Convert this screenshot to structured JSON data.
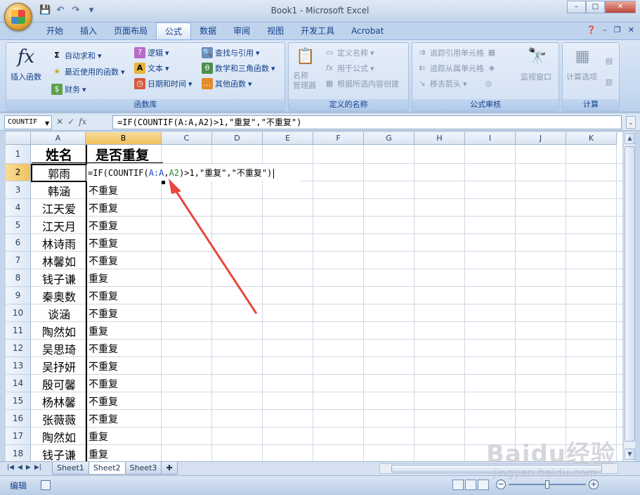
{
  "window": {
    "title": "Book1 - Microsoft Excel",
    "controls": [
      "–",
      "□",
      "✕"
    ]
  },
  "qat": [
    "save-icon",
    "undo-icon",
    "redo-icon",
    "customize-icon"
  ],
  "tabs": [
    {
      "label": "开始"
    },
    {
      "label": "插入"
    },
    {
      "label": "页面布局"
    },
    {
      "label": "公式",
      "active": true
    },
    {
      "label": "数据"
    },
    {
      "label": "审阅"
    },
    {
      "label": "视图"
    },
    {
      "label": "开发工具"
    },
    {
      "label": "Acrobat"
    }
  ],
  "ribbon": {
    "function_library": {
      "label": "函数库",
      "insert_function": "插入函数",
      "autosum": "自动求和",
      "recent": "最近使用的函数",
      "financial": "财务",
      "logical": "逻辑",
      "text": "文本",
      "datetime": "日期和时间",
      "lookup": "查找与引用",
      "math": "数学和三角函数",
      "more": "其他函数"
    },
    "defined_names": {
      "label": "定义的名称",
      "name_manager": "名称\n管理器",
      "define_name": "定义名称",
      "use_in_formula": "用于公式",
      "create_from_selection": "根据所选内容创建"
    },
    "formula_auditing": {
      "label": "公式审核",
      "trace_precedents": "追踪引用单元格",
      "trace_dependents": "追踪从属单元格",
      "remove_arrows": "移去箭头",
      "watch_window": "监视窗口"
    },
    "calculation": {
      "label": "计算",
      "calc_options": "计算选项"
    }
  },
  "formula_bar": {
    "name_box": "COUNTIF",
    "formula": "=IF(COUNTIF(A:A,A2)>1,\"重复\",\"不重复\")"
  },
  "editing": {
    "prefix": "=IF(COUNTIF(",
    "ref1": "A:A",
    "comma": ",",
    "ref2": "A2",
    "suffix": ")>1,\"重复\",\"不重复\")"
  },
  "columns": [
    "A",
    "B",
    "C",
    "D",
    "E",
    "F",
    "G",
    "H",
    "I",
    "J",
    "K"
  ],
  "rows": [
    {
      "n": "1",
      "a": "姓名",
      "b": "是否重复"
    },
    {
      "n": "2",
      "a": "郭雨",
      "b": ""
    },
    {
      "n": "3",
      "a": "韩涵",
      "b": "不重复"
    },
    {
      "n": "4",
      "a": "江天爱",
      "b": "不重复"
    },
    {
      "n": "5",
      "a": "江天月",
      "b": "不重复"
    },
    {
      "n": "6",
      "a": "林诗雨",
      "b": "不重复"
    },
    {
      "n": "7",
      "a": "林馨如",
      "b": "不重复"
    },
    {
      "n": "8",
      "a": "钱子谦",
      "b": "重复"
    },
    {
      "n": "9",
      "a": "秦奥数",
      "b": "不重复"
    },
    {
      "n": "10",
      "a": "谈涵",
      "b": "不重复"
    },
    {
      "n": "11",
      "a": "陶然如",
      "b": "重复"
    },
    {
      "n": "12",
      "a": "吴思琦",
      "b": "不重复"
    },
    {
      "n": "13",
      "a": "吴抒妍",
      "b": "不重复"
    },
    {
      "n": "14",
      "a": "殷可馨",
      "b": "不重复"
    },
    {
      "n": "15",
      "a": "杨林馨",
      "b": "不重复"
    },
    {
      "n": "16",
      "a": "张薇薇",
      "b": "不重复"
    },
    {
      "n": "17",
      "a": "陶然如",
      "b": "重复"
    },
    {
      "n": "18",
      "a": "钱子谦",
      "b": "重复"
    }
  ],
  "sheets": [
    {
      "label": "Sheet1"
    },
    {
      "label": "Sheet2",
      "active": true
    },
    {
      "label": "Sheet3"
    }
  ],
  "status": {
    "mode": "编辑"
  },
  "watermark": {
    "logo": "Baidu经验",
    "sub": "jingyan.baidu.com"
  },
  "colors": {
    "accent": "#15428b",
    "arrow": "#e8473e",
    "selected_header": "#f1c15f"
  }
}
